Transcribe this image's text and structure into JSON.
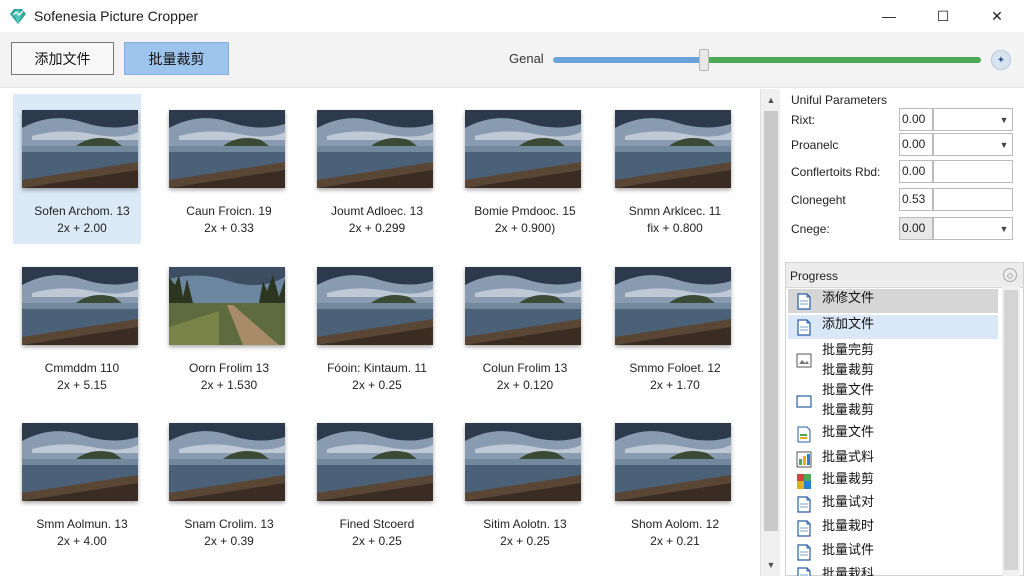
{
  "window": {
    "title": "Sofenesia Picture Cropper",
    "controls": {
      "minimize": "—",
      "maximize": "☐",
      "close": "✕"
    }
  },
  "toolbar": {
    "add_label": "添加文件",
    "batch_label": "批量裁剪",
    "slider_label": "Genal",
    "slider_level_fraction": 0.36,
    "colors": {
      "track_left": "#6aa2da",
      "track_right": "#4caa54",
      "batch_button": "#9cc4ec"
    }
  },
  "gallery": {
    "items": [
      {
        "name": "Sofen Archom. 13",
        "value": "2x + 2.00",
        "selected": true,
        "scene": "lake"
      },
      {
        "name": "Caun Froicn. 19",
        "value": "2x + 0.33",
        "selected": false,
        "scene": "lake"
      },
      {
        "name": "Joumt Adloec. 13",
        "value": "2x + 0.299",
        "selected": false,
        "scene": "lake"
      },
      {
        "name": "Bomie Pmdooc. 15",
        "value": "2x + 0.900)",
        "selected": false,
        "scene": "lake"
      },
      {
        "name": "Snmn Arklcec. 11",
        "value": "fix + 0.800",
        "selected": false,
        "scene": "lake"
      },
      {
        "name": "Cmmddm 110",
        "value": "2x + 5.15",
        "selected": false,
        "scene": "lake"
      },
      {
        "name": "Oorn Frolim 13",
        "value": "2x + 1.530",
        "selected": false,
        "scene": "path"
      },
      {
        "name": "Fóoin: Kintaum. 11",
        "value": "2x + 0.25",
        "selected": false,
        "scene": "lake"
      },
      {
        "name": "Colun Frolim 13",
        "value": "2x + 0.120",
        "selected": false,
        "scene": "lake"
      },
      {
        "name": "Smmo Foloet. 12",
        "value": "2x + 1.70",
        "selected": false,
        "scene": "lake"
      },
      {
        "name": "Smm Aolmun. 13",
        "value": "2x + 4.00",
        "selected": false,
        "scene": "lake"
      },
      {
        "name": "Snam Crolim. 13",
        "value": "2x + 0.39",
        "selected": false,
        "scene": "lake"
      },
      {
        "name": "Fined Stcoerd",
        "value": "2x + 0.25",
        "selected": false,
        "scene": "lake"
      },
      {
        "name": "Sitim Aolotn. 13",
        "value": "2x + 0.25",
        "selected": false,
        "scene": "lake"
      },
      {
        "name": "Shom Aolom. 12",
        "value": "2x + 0.21",
        "selected": false,
        "scene": "lake"
      }
    ],
    "scroll_up": "▲",
    "scroll_down": "▼"
  },
  "params": {
    "title": "Uniful Parameters",
    "rows": [
      {
        "label": "Rixt:",
        "value": "0.00",
        "has_select": true,
        "gray": false
      },
      {
        "label": "Proanelc",
        "value": "0.00",
        "has_select": true,
        "gray": false
      },
      {
        "label": "Conflertoits Rbd:",
        "value": "0.00",
        "has_select": false,
        "gray": false
      },
      {
        "label": "Clonegeht",
        "value": "0.53",
        "has_select": false,
        "gray": false
      },
      {
        "label": "Cnege:",
        "value": "0.00",
        "has_select": true,
        "gray": true
      }
    ],
    "dropdown_glyph": "▼"
  },
  "progress": {
    "title": "Progress",
    "head_icon": "◇",
    "items": [
      {
        "text": "添修文件",
        "icon": "doc-icon",
        "state": "active"
      },
      {
        "text": "添加文件",
        "icon": "doc-icon",
        "state": "hover"
      },
      {
        "text": "批量完剪\n批量裁剪",
        "icon": "image-icon",
        "state": ""
      },
      {
        "text": "批量文件\n批量裁剪",
        "icon": "folder-icon",
        "state": ""
      },
      {
        "text": "批量文件",
        "icon": "doc-green-icon",
        "state": ""
      },
      {
        "text": "批量式料",
        "icon": "chart-icon",
        "state": ""
      },
      {
        "text": "批量裁剪",
        "icon": "color-icon",
        "state": ""
      },
      {
        "text": "批量试对",
        "icon": "doc-icon",
        "state": ""
      },
      {
        "text": "批量栽时",
        "icon": "doc-icon",
        "state": ""
      },
      {
        "text": "批量试件",
        "icon": "doc-icon",
        "state": ""
      },
      {
        "text": "批量栽科",
        "icon": "doc-icon",
        "state": ""
      }
    ]
  }
}
